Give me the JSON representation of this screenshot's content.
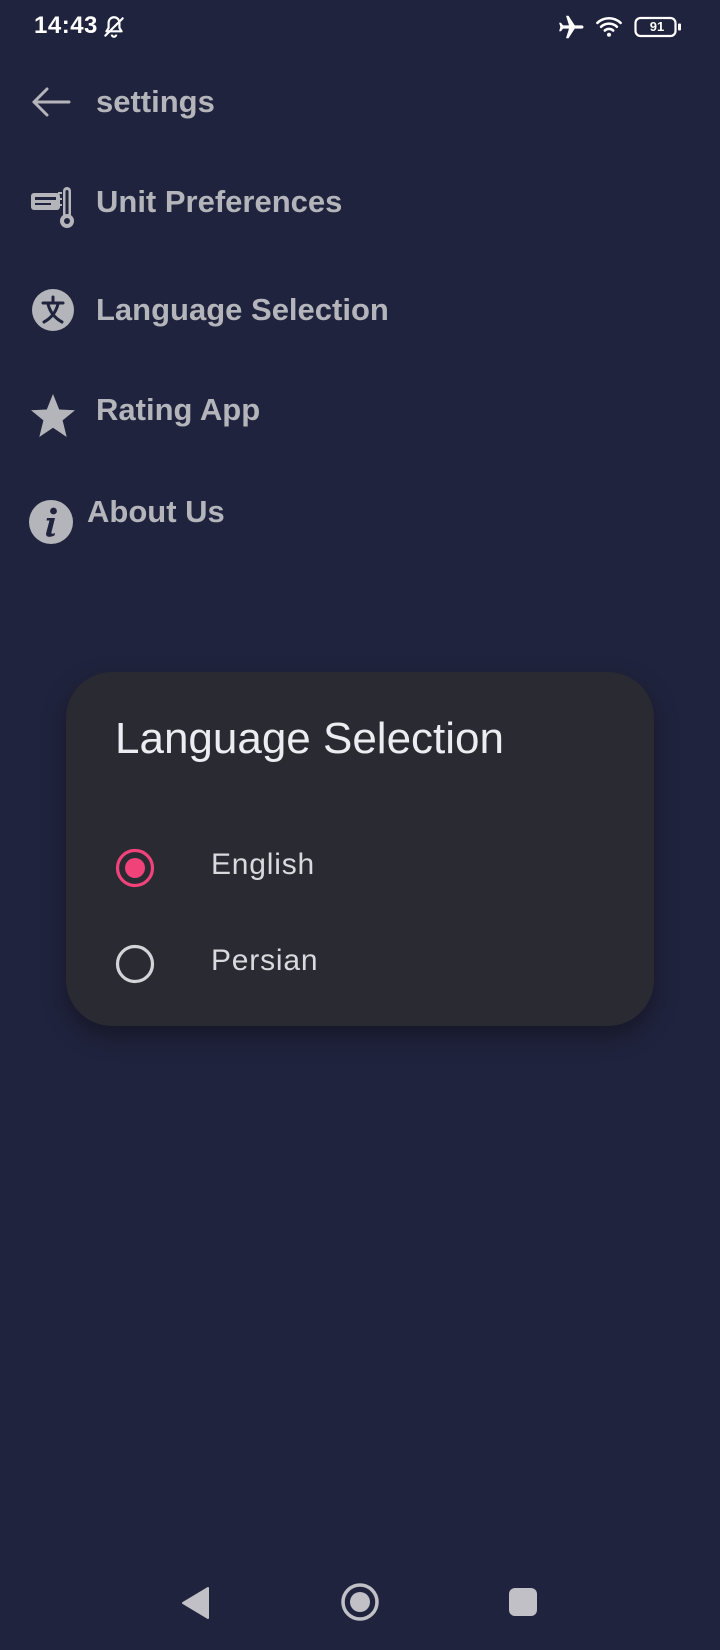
{
  "status_bar": {
    "time": "14:43",
    "battery": "91",
    "icons": [
      "bell-off-icon",
      "airplane-icon",
      "wifi-icon",
      "battery-icon"
    ]
  },
  "header": {
    "title": "settings",
    "back_icon": "arrow-left-icon"
  },
  "menu": {
    "items": [
      {
        "label": "Unit Preferences",
        "icon": "thermometer-icon"
      },
      {
        "label": "Language Selection",
        "icon": "translate-icon"
      },
      {
        "label": "Rating App",
        "icon": "star-icon"
      },
      {
        "label": "About Us",
        "icon": "info-icon"
      }
    ]
  },
  "dialog": {
    "title": "Language Selection",
    "options": [
      {
        "label": "English",
        "selected": true
      },
      {
        "label": "Persian",
        "selected": false
      }
    ]
  },
  "nav_bar": {
    "icons": [
      "nav-back-icon",
      "nav-home-icon",
      "nav-recents-icon"
    ]
  },
  "colors": {
    "background": "#20233d",
    "text_muted": "#b4b5bb",
    "dialog_bg": "#2a2a33",
    "accent": "#f2427a"
  }
}
